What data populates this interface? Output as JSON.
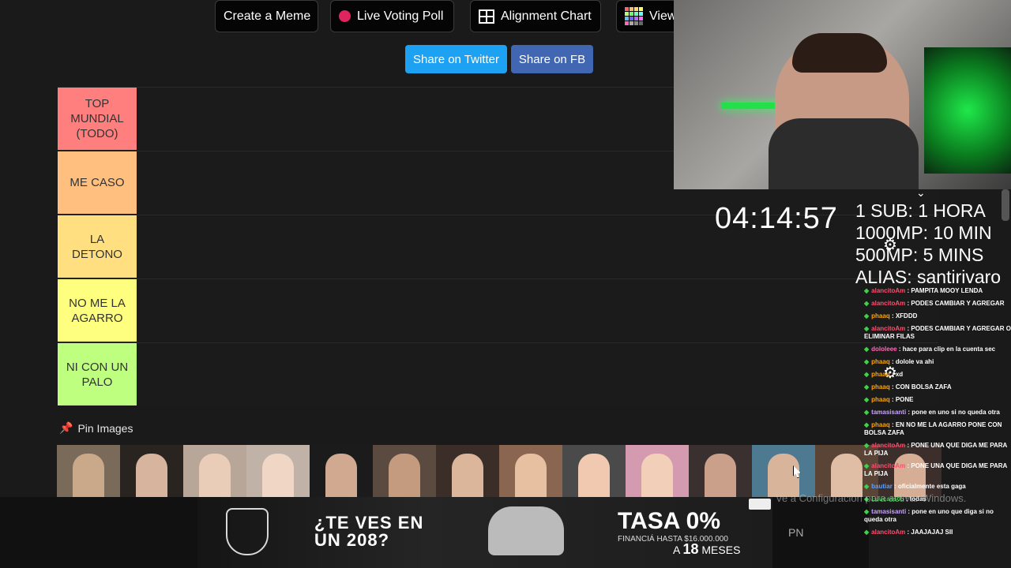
{
  "toolbar": {
    "create_meme": "Create a Meme",
    "live_poll": "Live Voting Poll",
    "alignment_chart": "Alignment Chart",
    "view": "View"
  },
  "share": {
    "twitter": "Share on Twitter",
    "facebook": "Share on FB",
    "twitter_color": "#1da1f2",
    "facebook_color": "#4267b2"
  },
  "tiers": [
    {
      "label": "TOP MUNDIAL (TODO)",
      "color": "#ff7f7f"
    },
    {
      "label": "ME CASO",
      "color": "#ffbf7f"
    },
    {
      "label": "LA DETONO",
      "color": "#ffdf7f"
    },
    {
      "label": "NO ME LA AGARRO",
      "color": "#ffff7f"
    },
    {
      "label": "NI CON UN PALO",
      "color": "#bfff7f"
    }
  ],
  "pin_images": {
    "label": "Pin Images",
    "count": 14
  },
  "ad": {
    "headline": "¿TE VES EN UN 208?",
    "rate": "TASA 0%",
    "financing": "FINANCIÁ HASTA $16.000.000",
    "months_prefix": "A",
    "months": "18",
    "months_suffix": "MESES",
    "side_text": "PN"
  },
  "stream": {
    "timer": "04:14:57",
    "goals": [
      "1 SUB: 1 HORA",
      "1000MP: 10 MIN",
      "500MP: 5 MINS",
      "ALIAS: santirivaro"
    ]
  },
  "chat": [
    {
      "user": "alancitoAm",
      "color": "#ff4d6d",
      "text": "PAMPITA MOOY LENDA"
    },
    {
      "user": "alancitoAm",
      "color": "#ff4d6d",
      "text": "PODES CAMBIAR Y AGREGAR"
    },
    {
      "user": "phaaq",
      "color": "#ffa500",
      "text": "XFDDD"
    },
    {
      "user": "alancitoAm",
      "color": "#ff4d6d",
      "text": "PODES CAMBIAR Y AGREGAR O ELIMINAR FILAS"
    },
    {
      "user": "dololeee",
      "color": "#ff69b4",
      "text": "hace para clip en la cuenta sec"
    },
    {
      "user": "phaaq",
      "color": "#ffa500",
      "text": "dolole va ahi"
    },
    {
      "user": "phaaq",
      "color": "#ffa500",
      "text": "xd"
    },
    {
      "user": "phaaq",
      "color": "#ffa500",
      "text": "CON BOLSA ZAFA"
    },
    {
      "user": "phaaq",
      "color": "#ffa500",
      "text": "PONE"
    },
    {
      "user": "tamasisanti",
      "color": "#c8a2ff",
      "text": "pone en uno si no queda otra"
    },
    {
      "user": "phaaq",
      "color": "#ffa500",
      "text": "EN NO ME LA AGARRO PONE CON BOLSA ZAFA"
    },
    {
      "user": "alancitoAm",
      "color": "#ff4d6d",
      "text": "PONE UNA QUE DIGA ME PARA LA PIJA"
    },
    {
      "user": "alancitoAm",
      "color": "#ff4d6d",
      "text": "PONE UNA QUE DIGA ME PARA LA PIJA"
    },
    {
      "user": "bautiar",
      "color": "#5aa0ff",
      "text": "oficialmente esta gaga"
    },
    {
      "user": "Luucass05",
      "color": "#3fd14a",
      "text": "todas"
    },
    {
      "user": "tamasisanti",
      "color": "#c8a2ff",
      "text": "pone en uno que diga si no queda otra"
    },
    {
      "user": "alancitoAm",
      "color": "#ff4d6d",
      "text": "JAAJAJAJ SII"
    }
  ],
  "watermark": "Ve a Configuración para activar Windows."
}
